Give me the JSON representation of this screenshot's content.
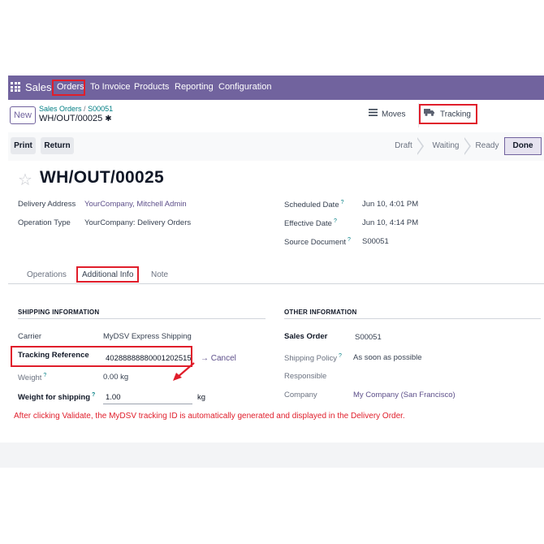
{
  "navbar": {
    "brand": "Sales",
    "items": [
      "Orders",
      "To Invoice",
      "Products",
      "Reporting",
      "Configuration"
    ]
  },
  "control": {
    "new_label": "New",
    "breadcrumb_parent": "Sales Orders",
    "breadcrumb_sep": "/",
    "breadcrumb_order": "S00051",
    "record_name": "WH/OUT/00025",
    "moves_label": "Moves",
    "tracking_label": "Tracking"
  },
  "statusbar": {
    "print_label": "Print",
    "return_label": "Return",
    "stages": [
      "Draft",
      "Waiting",
      "Ready",
      "Done"
    ],
    "active_stage": "Done"
  },
  "record": {
    "title": "WH/OUT/00025",
    "delivery_address_label": "Delivery Address",
    "delivery_address": "YourCompany, Mitchell Admin",
    "operation_type_label": "Operation Type",
    "operation_type": "YourCompany: Delivery Orders",
    "scheduled_date_label": "Scheduled Date",
    "scheduled_date": "Jun 10, 4:01 PM",
    "effective_date_label": "Effective Date",
    "effective_date": "Jun 10, 4:14 PM",
    "source_document_label": "Source Document",
    "source_document": "S00051",
    "help_mark": "?"
  },
  "tabs": [
    "Operations",
    "Additional Info",
    "Note"
  ],
  "shipping": {
    "title": "SHIPPING INFORMATION",
    "carrier_label": "Carrier",
    "carrier": "MyDSV Express Shipping",
    "tracking_ref_label": "Tracking Reference",
    "tracking_ref": "40288888880001202515",
    "cancel_label": "→ Cancel",
    "weight_label": "Weight",
    "weight": "0.00 kg",
    "weight_for_shipping_label": "Weight for shipping",
    "weight_for_shipping": "1.00",
    "weight_unit": "kg"
  },
  "other": {
    "title": "OTHER INFORMATION",
    "sales_order_label": "Sales Order",
    "sales_order": "S00051",
    "shipping_policy_label": "Shipping Policy",
    "shipping_policy": "As soon as possible",
    "responsible_label": "Responsible",
    "company_label": "Company",
    "company": "My Company (San Francisco)"
  },
  "annotation": "After clicking Validate, the MyDSV tracking ID is automatically generated and displayed in the Delivery Order.",
  "colors": {
    "brand": "#71639e",
    "highlight": "#e01e2b",
    "link": "#017e84"
  }
}
